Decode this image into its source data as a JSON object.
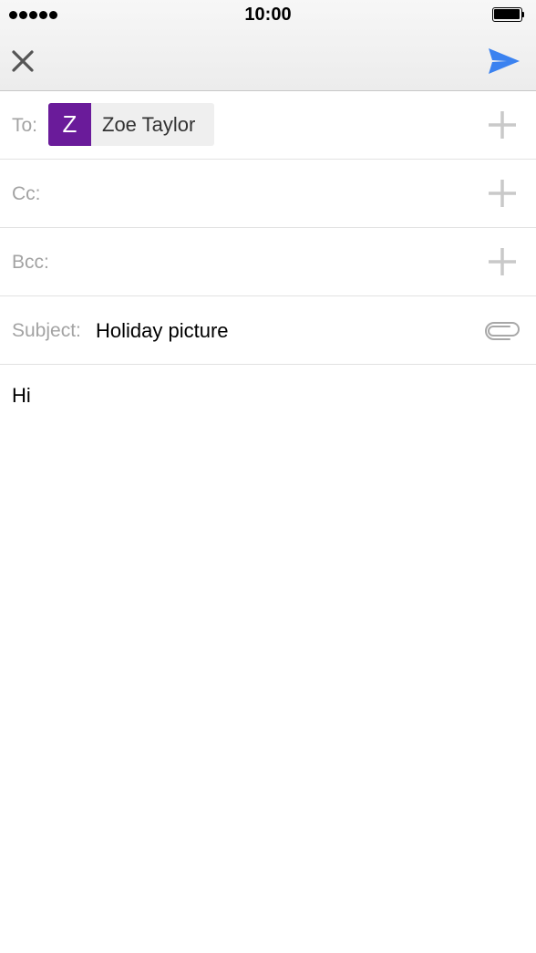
{
  "status_bar": {
    "time": "10:00",
    "signal_icon": "signal-dots-icon",
    "battery_icon": "battery-full-icon"
  },
  "nav": {
    "close_icon": "close-icon",
    "send_icon": "send-icon",
    "send_color": "#3b82f0"
  },
  "fields": {
    "to_label": "To:",
    "cc_label": "Cc:",
    "bcc_label": "Bcc:",
    "subject_label": "Subject:",
    "add_icon": "plus-icon",
    "attach_icon": "paperclip-icon"
  },
  "recipient": {
    "initial": "Z",
    "name": "Zoe Taylor",
    "avatar_color": "#6a1b9a"
  },
  "subject": {
    "value": "Holiday picture"
  },
  "body": {
    "text": "Hi"
  }
}
